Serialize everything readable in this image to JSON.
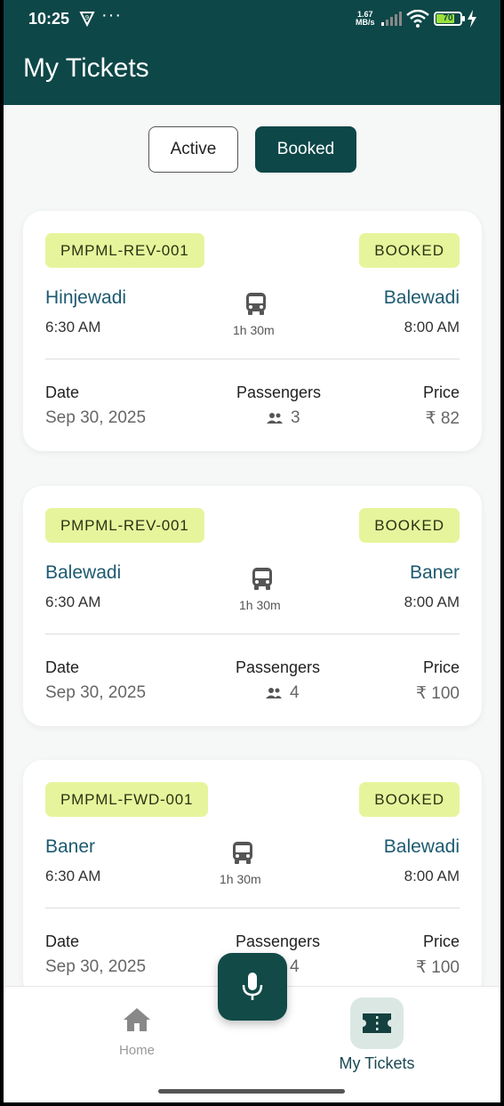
{
  "status_bar": {
    "time": "10:25",
    "net_speed_value": "1.67",
    "net_speed_unit": "MB/s",
    "battery_level": "70"
  },
  "app_bar": {
    "title": "My Tickets"
  },
  "filters": {
    "active_label": "Active",
    "booked_label": "Booked",
    "selected": "Booked"
  },
  "labels": {
    "date": "Date",
    "passengers": "Passengers",
    "price": "Price"
  },
  "tickets": [
    {
      "code": "PMPML-REV-001",
      "status": "BOOKED",
      "from": "Hinjewadi",
      "to": "Balewadi",
      "depart": "6:30 AM",
      "arrive": "8:00 AM",
      "duration": "1h 30m",
      "date": "Sep 30, 2025",
      "passengers": "3",
      "price": "₹ 82"
    },
    {
      "code": "PMPML-REV-001",
      "status": "BOOKED",
      "from": "Balewadi",
      "to": "Baner",
      "depart": "6:30 AM",
      "arrive": "8:00 AM",
      "duration": "1h 30m",
      "date": "Sep 30, 2025",
      "passengers": "4",
      "price": "₹ 100"
    },
    {
      "code": "PMPML-FWD-001",
      "status": "BOOKED",
      "from": "Baner",
      "to": "Balewadi",
      "depart": "6:30 AM",
      "arrive": "8:00 AM",
      "duration": "1h 30m",
      "date": "Sep 30, 2025",
      "passengers": "4",
      "price": "₹ 100"
    }
  ],
  "bottom_nav": {
    "home_label": "Home",
    "tickets_label": "My Tickets",
    "selected": "My Tickets"
  },
  "colors": {
    "primary": "#0e4748",
    "badge_bg": "#e6f59c",
    "city_text": "#1d5a70",
    "nav_selected_bg": "#dbe7e3"
  },
  "icons": {
    "home": "home-icon",
    "tickets": "ticket-icon",
    "mic": "mic-icon",
    "bus": "bus-icon",
    "passengers": "people-icon"
  }
}
